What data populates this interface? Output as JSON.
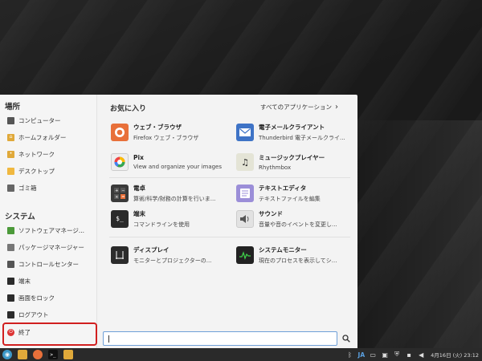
{
  "sidebar": {
    "places_title": "場所",
    "places": [
      {
        "label": "コンピューター",
        "icon": "computer-icon"
      },
      {
        "label": "ホームフォルダー",
        "icon": "home-folder-icon"
      },
      {
        "label": "ネットワーク",
        "icon": "network-folder-icon"
      },
      {
        "label": "デスクトップ",
        "icon": "desktop-folder-icon"
      },
      {
        "label": "ゴミ箱",
        "icon": "trash-icon"
      }
    ],
    "system_title": "システム",
    "system": [
      {
        "label": "ソフトウェアマネージ...",
        "icon": "software-manager-icon"
      },
      {
        "label": "パッケージマネージャー",
        "icon": "package-manager-icon"
      },
      {
        "label": "コントロールセンター",
        "icon": "control-center-icon"
      },
      {
        "label": "端末",
        "icon": "terminal-icon"
      },
      {
        "label": "画面をロック",
        "icon": "lock-screen-icon"
      },
      {
        "label": "ログアウト",
        "icon": "logout-icon"
      },
      {
        "label": "終了",
        "icon": "power-icon"
      }
    ]
  },
  "favorites": {
    "title": "お気に入り",
    "all_apps_label": "すべてのアプリケーション",
    "apps": [
      {
        "name": "ウェブ・ブラウザ",
        "desc": "Firefox ウェブ・ブラウザ",
        "icon": "firefox-icon"
      },
      {
        "name": "電子メールクライアント",
        "desc": "Thunderbird 電子メールクライ...",
        "icon": "mail-icon"
      },
      {
        "name": "Pix",
        "desc": "View and organize your images",
        "icon": "pix-icon"
      },
      {
        "name": "ミュージックプレイヤー",
        "desc": "Rhythmbox",
        "icon": "music-icon"
      },
      {
        "name": "電卓",
        "desc": "算術/科学/財務の計算を行いま...",
        "icon": "calculator-icon"
      },
      {
        "name": "テキストエディタ",
        "desc": "テキストファイルを編集",
        "icon": "text-editor-icon"
      },
      {
        "name": "端末",
        "desc": "コマンドラインを使用",
        "icon": "terminal-app-icon"
      },
      {
        "name": "サウンド",
        "desc": "音量や音のイベントを変更し...",
        "icon": "sound-icon"
      },
      {
        "name": "ディスプレイ",
        "desc": "モニターとプロジェクターの...",
        "icon": "display-icon"
      },
      {
        "name": "システムモニター",
        "desc": "現在のプロセスを表示してシ...",
        "icon": "system-monitor-icon"
      }
    ]
  },
  "search": {
    "value": ""
  },
  "taskbar": {
    "ime": "JA",
    "clock": "4月16日 (火) 23:12"
  },
  "colors": {
    "quit_highlight": "#d11f1f",
    "search_border": "#6fa0d8",
    "ime_accent": "#5aa0e0"
  }
}
